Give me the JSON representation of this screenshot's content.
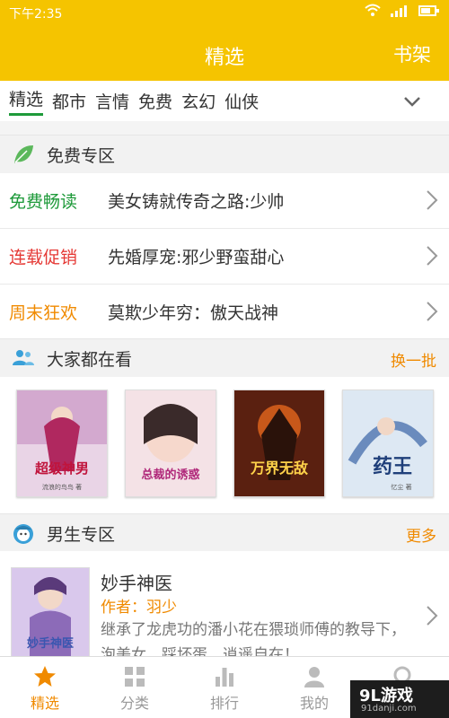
{
  "status": {
    "time": "下午2:35"
  },
  "appbar": {
    "title": "精选",
    "right": "书架"
  },
  "tabs": [
    "精选",
    "都市",
    "言情",
    "免费",
    "玄幻",
    "仙侠"
  ],
  "free_zone": {
    "title": "免费专区",
    "rows": [
      {
        "tag": "免费畅读",
        "tag_color": "#1e9a3a",
        "text": "美女铸就传奇之路:少帅"
      },
      {
        "tag": "连载促销",
        "tag_color": "#e53935",
        "text": "先婚厚宠:邪少野蛮甜心"
      },
      {
        "tag": "周末狂欢",
        "tag_color": "#f08a00",
        "text": "莫欺少年穷：傲天战神"
      }
    ]
  },
  "popular": {
    "title": "大家都在看",
    "action": "换一批",
    "covers": [
      {
        "title": "超级神男",
        "author": "流浪的鸟鸟 著"
      },
      {
        "title": "总裁的诱惑",
        "author": ""
      },
      {
        "title": "万界无敌",
        "author": ""
      },
      {
        "title": "药王",
        "author": "忆尘 著"
      }
    ]
  },
  "male_zone": {
    "title": "男生专区",
    "action": "更多",
    "book": {
      "cover_text": "妙手神医",
      "title": "妙手神医",
      "author": "作者：羽少",
      "desc": "继承了龙虎功的潘小花在猥琐师傅的教导下，泡美女、踩坏蛋，逍遥自在！"
    }
  },
  "bottom_nav": [
    {
      "label": "精选",
      "icon": "star-icon"
    },
    {
      "label": "分类",
      "icon": "grid-icon"
    },
    {
      "label": "排行",
      "icon": "bar-chart-icon"
    },
    {
      "label": "我的",
      "icon": "person-icon"
    },
    {
      "label": "",
      "icon": "search-icon"
    }
  ],
  "watermark": {
    "big": "9L游戏",
    "small": "91danji.com"
  },
  "colors": {
    "accent": "#f5c400",
    "orange": "#f08a00",
    "green": "#1e9a3a",
    "red": "#e53935"
  }
}
